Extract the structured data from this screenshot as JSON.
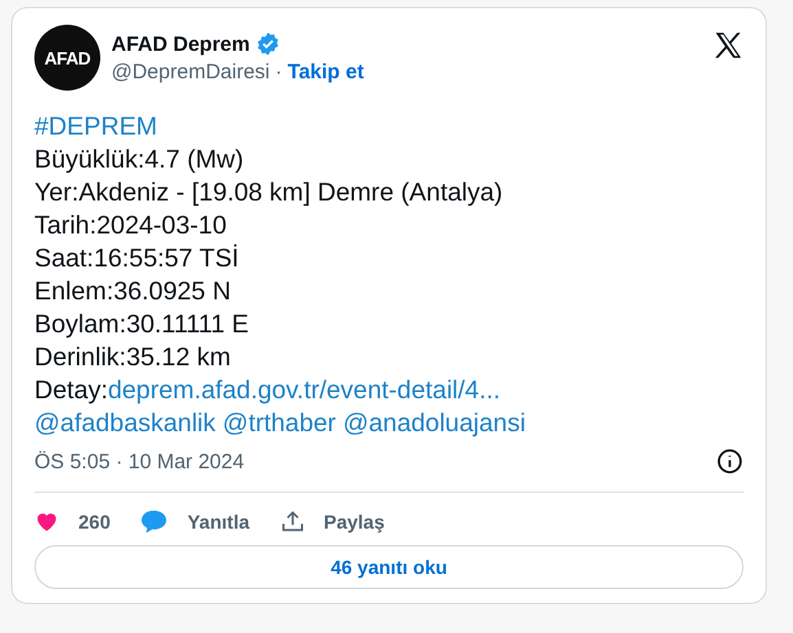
{
  "author": {
    "avatar_text": "AFAD",
    "name": "AFAD Deprem",
    "handle": "@DepremDairesi",
    "separator": "·",
    "follow": "Takip et"
  },
  "body": [
    {
      "kind": "link",
      "text": "#DEPREM"
    },
    {
      "kind": "text",
      "text": "Büyüklük:4.7 (Mw)"
    },
    {
      "kind": "text",
      "text": "Yer:Akdeniz - [19.08 km] Demre (Antalya)"
    },
    {
      "kind": "text",
      "text": "Tarih:2024-03-10"
    },
    {
      "kind": "text",
      "text": "Saat:16:55:57 TSİ"
    },
    {
      "kind": "text",
      "text": "Enlem:36.0925 N"
    },
    {
      "kind": "text",
      "text": "Boylam:30.11111 E"
    },
    {
      "kind": "text",
      "text": "Derinlik:35.12 km"
    },
    {
      "kind": "labeled_link",
      "label": "Detay:",
      "text": "deprem.afad.gov.tr/event-detail/4..."
    },
    {
      "kind": "mentions",
      "items": [
        "@afadbaskanlik",
        "@trthaber",
        "@anadoluajansi"
      ]
    }
  ],
  "timestamp": "ÖS 5:05 · 10 Mar 2024",
  "actions": [
    {
      "kind": "like",
      "label": "260"
    },
    {
      "kind": "reply",
      "label": "Yanıtla"
    },
    {
      "kind": "share",
      "label": "Paylaş"
    }
  ],
  "read_replies": "46 yanıtı oku"
}
